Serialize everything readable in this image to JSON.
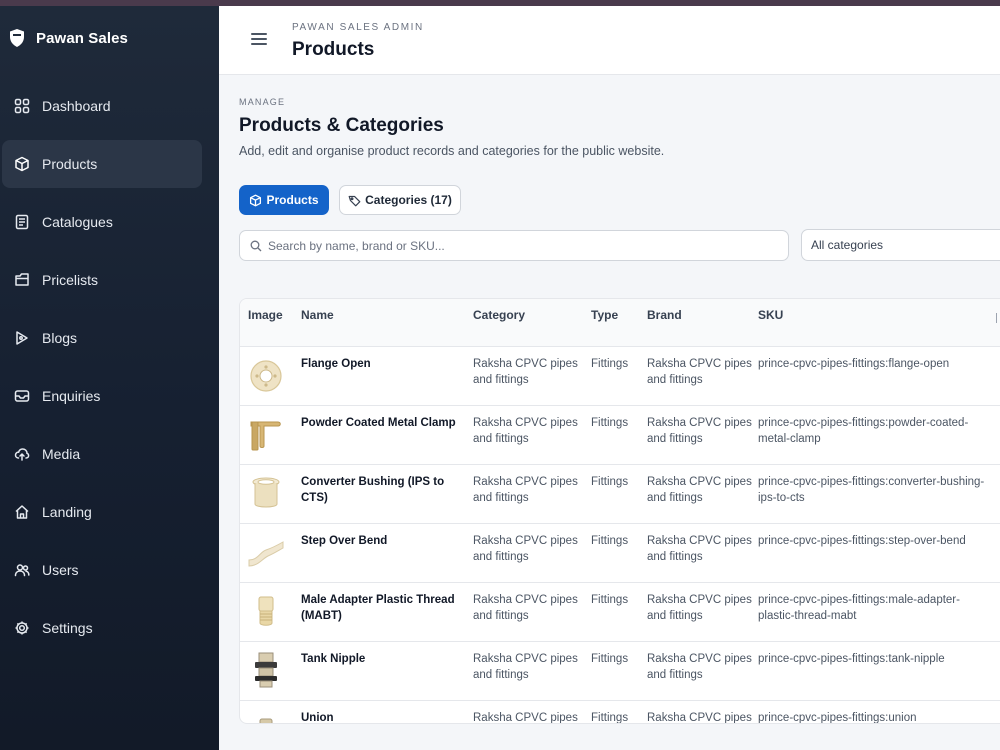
{
  "app": {
    "brand_name": "Pawan Sales"
  },
  "sidebar": {
    "items": [
      {
        "label": "Dashboard",
        "icon": "dashboard-grid-icon",
        "active": false
      },
      {
        "label": "Products",
        "icon": "cube-icon",
        "active": true
      },
      {
        "label": "Catalogues",
        "icon": "book-icon",
        "active": false
      },
      {
        "label": "Pricelists",
        "icon": "tag-icon",
        "active": false
      },
      {
        "label": "Blogs",
        "icon": "pen-icon",
        "active": false
      },
      {
        "label": "Enquiries",
        "icon": "mail-icon",
        "active": false
      },
      {
        "label": "Media",
        "icon": "cloud-icon",
        "active": false
      },
      {
        "label": "Landing",
        "icon": "home-icon",
        "active": false
      },
      {
        "label": "Users",
        "icon": "users-icon",
        "active": false
      },
      {
        "label": "Settings",
        "icon": "gear-icon",
        "active": false
      }
    ]
  },
  "header": {
    "eyebrow": "PAWAN SALES ADMIN",
    "title": "Products"
  },
  "section": {
    "label": "MANAGE",
    "title": "Products & Categories",
    "description": "Add, edit and organise product records and categories for the public website."
  },
  "tabs": [
    {
      "label": "Products",
      "active": true
    },
    {
      "label": "Categories (17)",
      "active": false
    }
  ],
  "search": {
    "placeholder": "Search by name, brand or SKU..."
  },
  "filter": {
    "selected": "All categories"
  },
  "table": {
    "columns": [
      "Image",
      "Name",
      "Category",
      "Type",
      "Brand",
      "SKU"
    ],
    "rows": [
      {
        "name": "Flange Open",
        "category": "Raksha CPVC pipes and fittings",
        "type": "Fittings",
        "brand": "Raksha CPVC pipes and fittings",
        "sku": "prince-cpvc-pipes-fittings:flange-open"
      },
      {
        "name": "Powder Coated Metal Clamp",
        "category": "Raksha CPVC pipes and fittings",
        "type": "Fittings",
        "brand": "Raksha CPVC pipes and fittings",
        "sku": "prince-cpvc-pipes-fittings:powder-coated-metal-clamp"
      },
      {
        "name": "Converter Bushing (IPS to CTS)",
        "category": "Raksha CPVC pipes and fittings",
        "type": "Fittings",
        "brand": "Raksha CPVC pipes and fittings",
        "sku": "prince-cpvc-pipes-fittings:converter-bushing-ips-to-cts"
      },
      {
        "name": "Step Over Bend",
        "category": "Raksha CPVC pipes and fittings",
        "type": "Fittings",
        "brand": "Raksha CPVC pipes and fittings",
        "sku": "prince-cpvc-pipes-fittings:step-over-bend"
      },
      {
        "name": "Male Adapter Plastic Thread (MABT)",
        "category": "Raksha CPVC pipes and fittings",
        "type": "Fittings",
        "brand": "Raksha CPVC pipes and fittings",
        "sku": "prince-cpvc-pipes-fittings:male-adapter-plastic-thread-mabt"
      },
      {
        "name": "Tank Nipple",
        "category": "Raksha CPVC pipes and fittings",
        "type": "Fittings",
        "brand": "Raksha CPVC pipes and fittings",
        "sku": "prince-cpvc-pipes-fittings:tank-nipple"
      },
      {
        "name": "Union",
        "category": "Raksha CPVC pipes and fittings",
        "type": "Fittings",
        "brand": "Raksha CPVC pipes and fittings",
        "sku": "prince-cpvc-pipes-fittings:union"
      }
    ]
  },
  "colors": {
    "accent": "#1463c9",
    "sidebar_bg": "#1b2535",
    "page_bg": "#f4f6f9"
  }
}
